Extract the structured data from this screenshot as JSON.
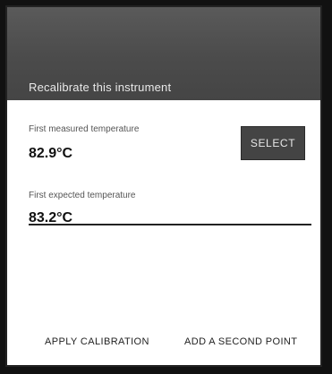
{
  "dialog": {
    "title": "Recalibrate this instrument",
    "first_measured": {
      "label": "First measured temperature",
      "value": "82.9°C"
    },
    "select_label": "SELECT",
    "first_expected": {
      "label": "First expected temperature",
      "value": "83.2°C"
    },
    "actions": {
      "apply": "APPLY CALIBRATION",
      "add_point": "ADD A SECOND POINT"
    }
  }
}
